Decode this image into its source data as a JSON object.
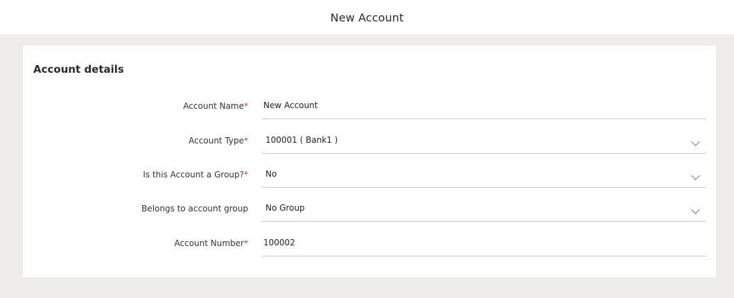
{
  "header": {
    "title": "New Account"
  },
  "card": {
    "title": "Account details"
  },
  "form": {
    "account_name": {
      "label": "Account Name",
      "required_mark": "*",
      "value": "New Account"
    },
    "account_type": {
      "label": "Account Type",
      "required_mark": "*",
      "value": "100001 ( Bank1 )",
      "icon": "chevron-down-icon"
    },
    "is_group": {
      "label": "Is this Account a Group?",
      "required_mark": "*",
      "value": "No",
      "icon": "chevron-down-icon"
    },
    "account_group": {
      "label": "Belongs to account group",
      "value": "No Group",
      "icon": "chevron-down-icon"
    },
    "account_number": {
      "label": "Account Number",
      "required_mark": "*",
      "value": "100002"
    }
  }
}
